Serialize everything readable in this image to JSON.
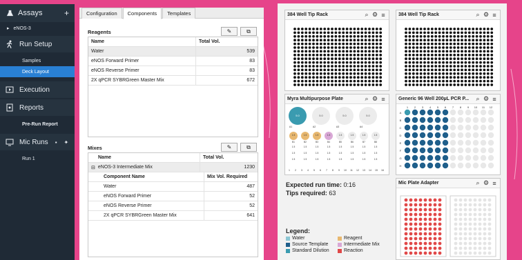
{
  "colors": {
    "water": "#8cc7d4",
    "source_template": "#1f5f8b",
    "standard_dilution": "#3a9bb0",
    "reagent": "#e8b870",
    "intermediate_mix": "#d9a8d6",
    "reaction": "#e04848",
    "accent": "#2980d4"
  },
  "sidebar": {
    "assays": "Assays",
    "assay_item": "eNOS-3",
    "run_setup": "Run Setup",
    "samples": "Samples",
    "deck_layout": "Deck Layout",
    "execution": "Execution",
    "reports": "Reports",
    "pre_run_report": "Pre-Run Report",
    "mic_runs": "Mic Runs",
    "run_1": "Run 1"
  },
  "tabs": [
    "Configuration",
    "Components",
    "Templates"
  ],
  "reagents": {
    "title": "Reagents",
    "headers": [
      "Name",
      "Total Vol."
    ],
    "rows": [
      {
        "name": "Water",
        "vol": "539"
      },
      {
        "name": "eNOS Forward Primer",
        "vol": "83"
      },
      {
        "name": "eNOS Reverse Primer",
        "vol": "83"
      },
      {
        "name": "2X qPCR SYBRGreen Master Mix",
        "vol": "672"
      }
    ]
  },
  "mixes": {
    "title": "Mixes",
    "headers": [
      "Name",
      "Total Vol."
    ],
    "mix_name": "eNOS-3 Intermediate Mix",
    "mix_vol": "1230",
    "sub_headers": [
      "Component Name",
      "Mix Vol. Required"
    ],
    "components": [
      {
        "name": "Water",
        "vol": "487"
      },
      {
        "name": "eNOS Forward Primer",
        "vol": "52"
      },
      {
        "name": "eNOS Reverse Primer",
        "vol": "52"
      },
      {
        "name": "2X qPCR SYBRGreen Master Mix",
        "vol": "641"
      }
    ]
  },
  "plates": {
    "tip_rack_1": "384 Well Tip Rack",
    "tip_rack_2": "384 Well Tip Rack",
    "myra": "Myra Multipurpose Plate",
    "pcr": "Generic 96 Well 200µL PCR P...",
    "mic": "Mic Plate Adapter",
    "myra_big_labels": [
      "A1",
      "A2",
      "A3",
      "A4"
    ],
    "myra_big_values": [
      "5.0",
      "5.0",
      "5.0",
      "5.0"
    ],
    "myra_row_labels": [
      "B1",
      "B2",
      "B3",
      "B4",
      "B5",
      "B6",
      "B7",
      "B8"
    ],
    "myra_small_value": "1.5",
    "myra_bottom_nums": [
      "1",
      "2",
      "3",
      "4",
      "5",
      "6",
      "7",
      "8",
      "9",
      "10",
      "11",
      "12",
      "13",
      "14",
      "15",
      "16"
    ],
    "pcr_cols": [
      "1",
      "2",
      "3",
      "4",
      "5",
      "6",
      "7",
      "8",
      "9",
      "10",
      "11",
      "12"
    ],
    "pcr_rows": [
      "A",
      "B",
      "C",
      "D",
      "E",
      "F",
      "G",
      "H"
    ]
  },
  "run_info": {
    "time_label": "Expected run time:",
    "time_value": "0:16",
    "tips_label": "Tips required:",
    "tips_value": "63"
  },
  "legend": {
    "title": "Legend:",
    "items": [
      "Water",
      "Reagent",
      "Source Template",
      "Intermediate Mix",
      "Standard Dilution",
      "Reaction"
    ]
  }
}
